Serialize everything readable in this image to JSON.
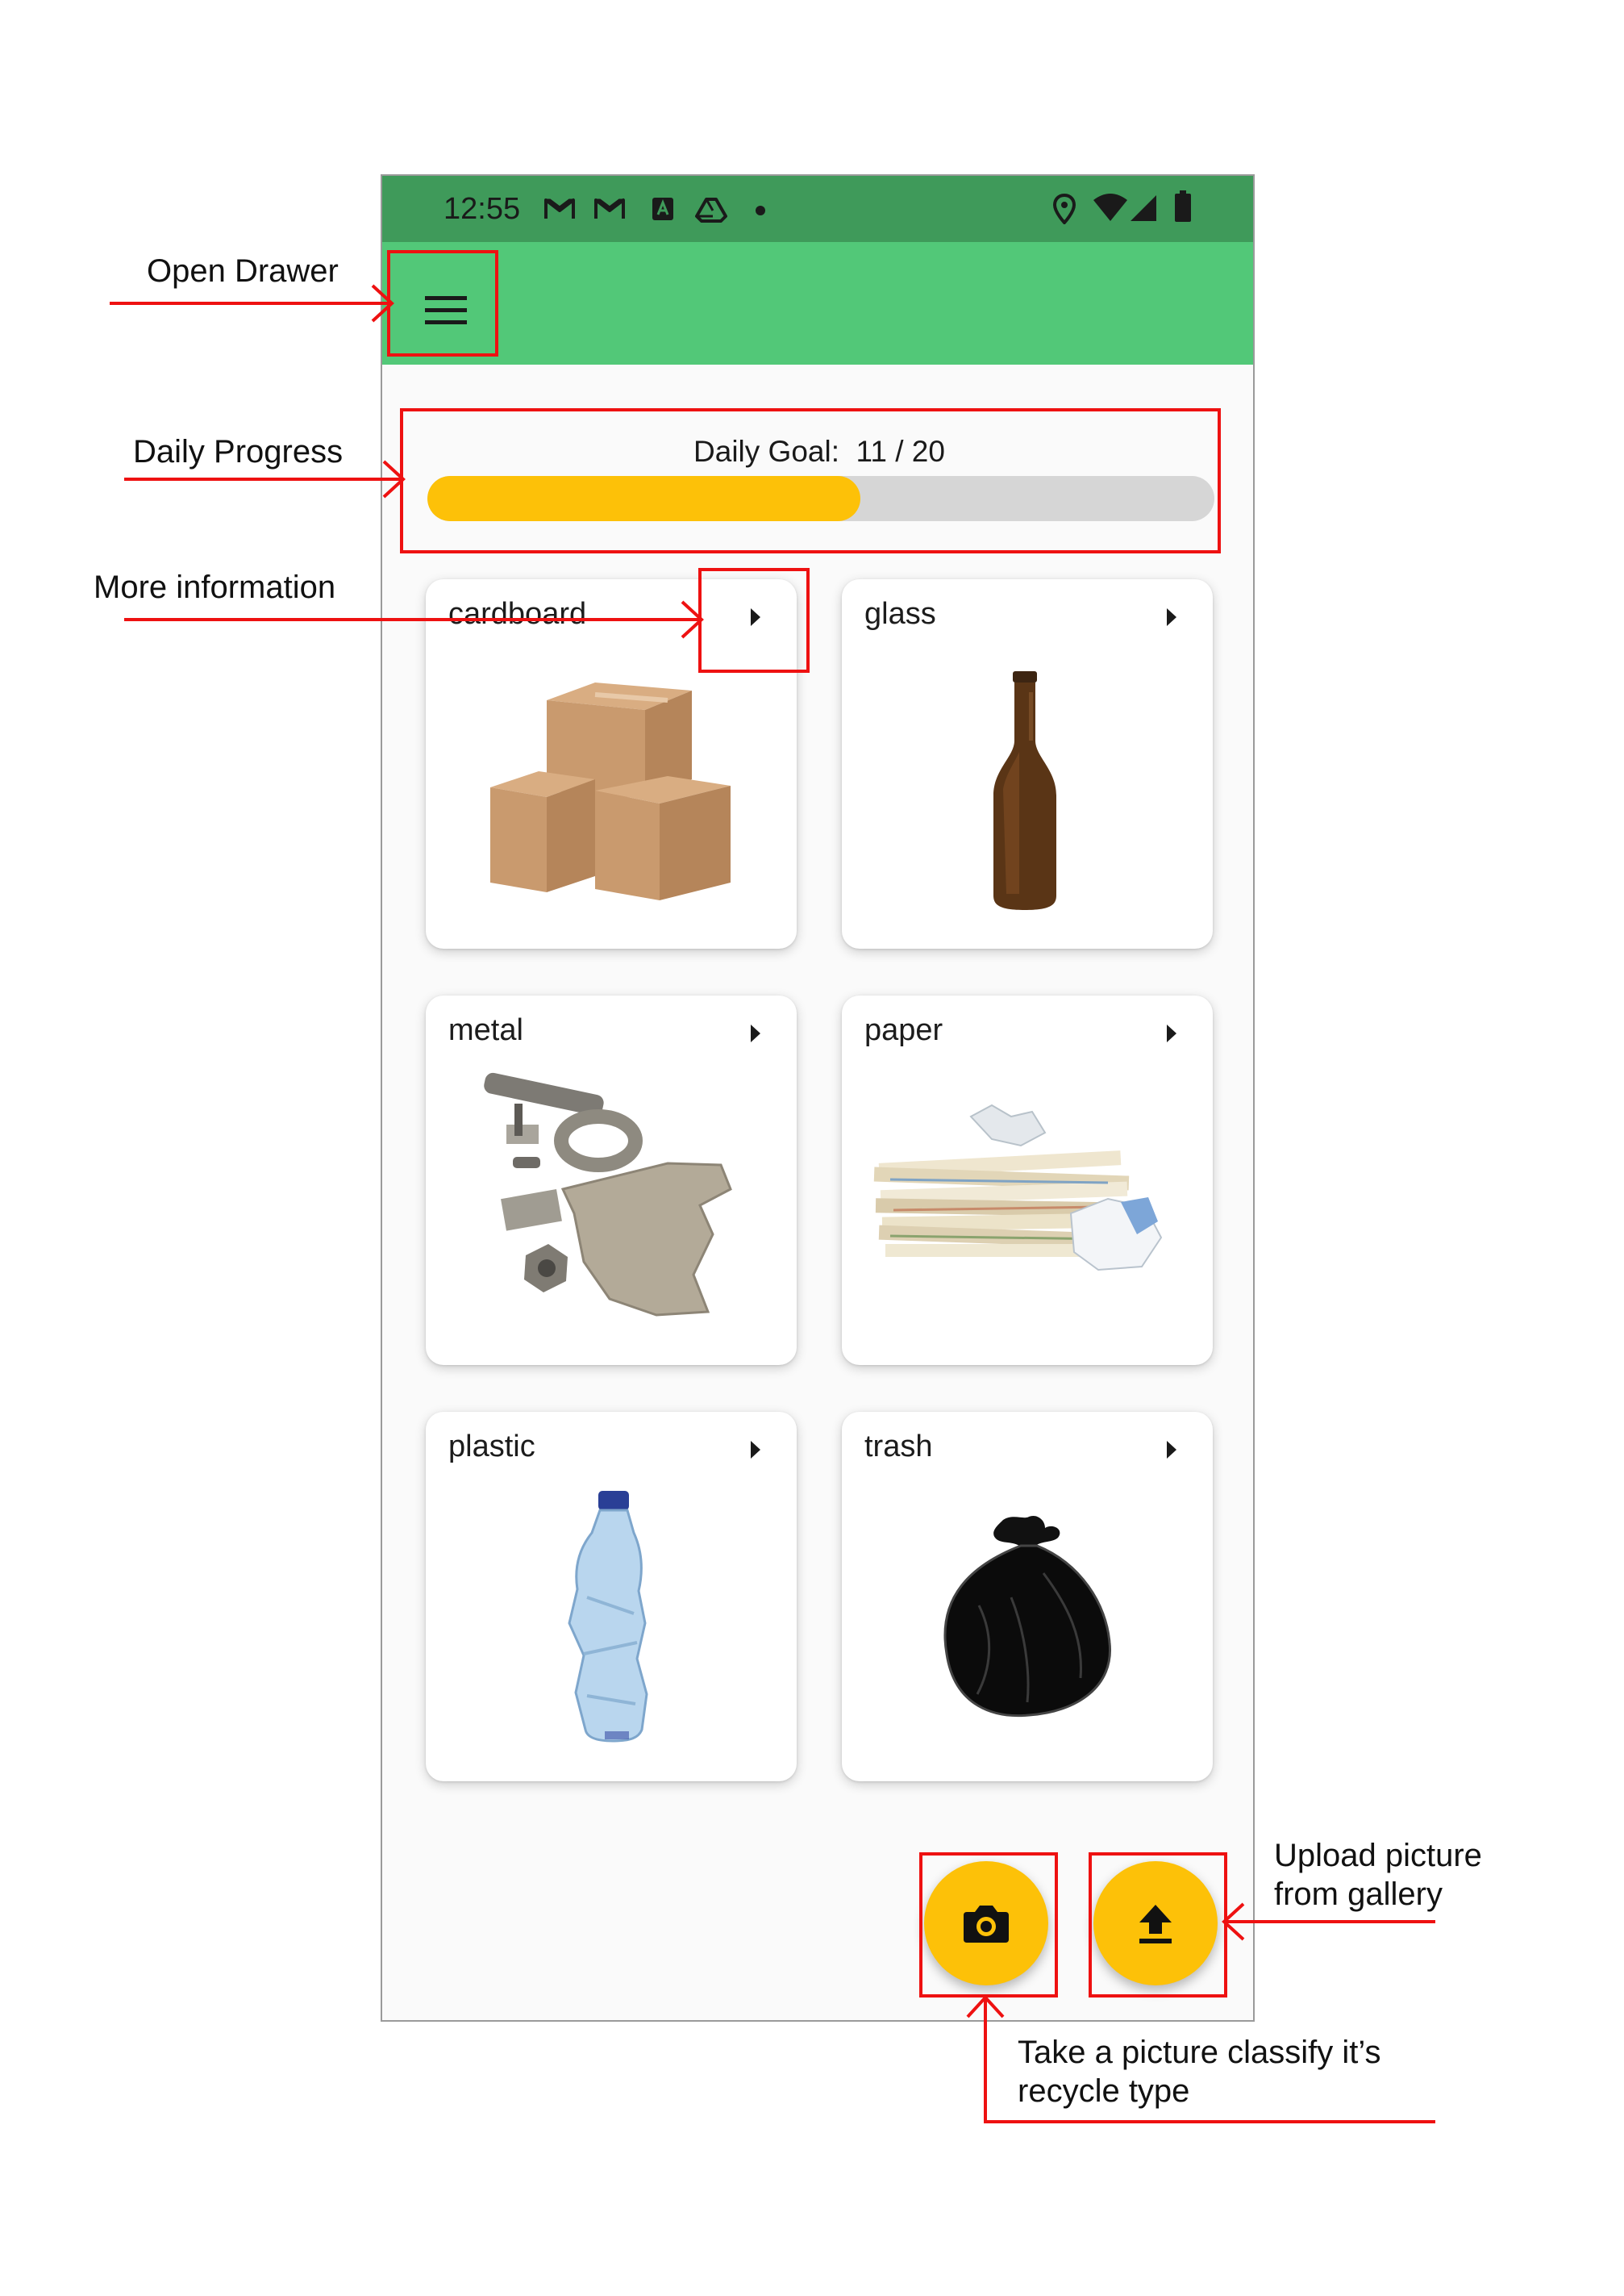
{
  "status_bar": {
    "time": "12:55",
    "left_icons": [
      "gmail-icon",
      "gmail-icon",
      "app-badge-icon",
      "drive-icon",
      "dot-icon"
    ],
    "right_icons": [
      "location-icon",
      "wifi-icon",
      "signal-icon",
      "battery-icon"
    ]
  },
  "app_bar": {
    "menu_icon": "menu-icon"
  },
  "progress": {
    "label": "Daily Goal:",
    "value_text": "11 / 20",
    "current": 11,
    "goal": 20,
    "fill_fraction": 0.55
  },
  "categories": [
    {
      "label": "cardboard",
      "image": "cardboard-boxes"
    },
    {
      "label": "glass",
      "image": "glass-bottle"
    },
    {
      "label": "metal",
      "image": "metal-scrap"
    },
    {
      "label": "paper",
      "image": "paper-stack"
    },
    {
      "label": "plastic",
      "image": "plastic-bottle"
    },
    {
      "label": "trash",
      "image": "trash-bag"
    }
  ],
  "fabs": {
    "camera_icon": "camera-icon",
    "upload_icon": "upload-icon"
  },
  "annotations": {
    "open_drawer": "Open Drawer",
    "daily_progress": "Daily Progress",
    "more_information": "More information",
    "upload_line1": "Upload picture",
    "upload_line2": "from gallery",
    "take_line1": "Take a picture classify it’s",
    "take_line2": "recycle type"
  },
  "colors": {
    "status_bar": "#3f9a5a",
    "app_bar": "#52c878",
    "accent": "#fdc108",
    "annotation_red": "#ee1111"
  }
}
